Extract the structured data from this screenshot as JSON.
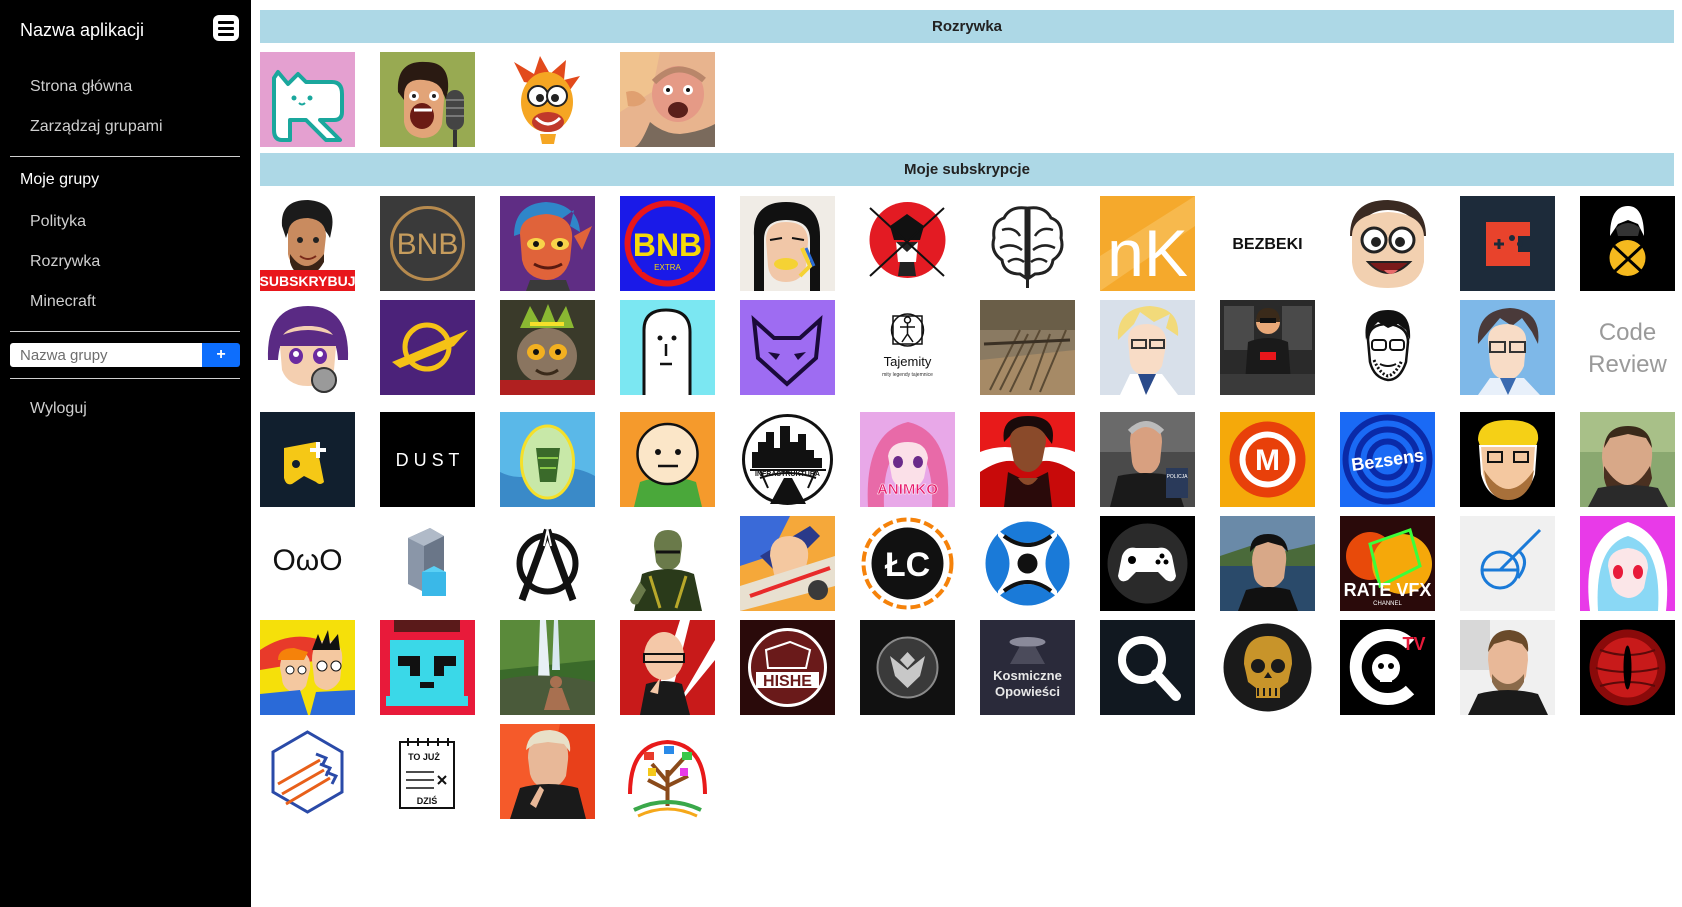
{
  "sidebar": {
    "app_title": "Nazwa aplikacji",
    "menu_icon": "hamburger-icon",
    "nav": [
      "Strona główna",
      "Zarządzaj grupami"
    ],
    "groups_title": "Moje grupy",
    "groups": [
      "Polityka",
      "Rozrywka",
      "Minecraft"
    ],
    "input_placeholder": "Nazwa grupy",
    "add_label": "+",
    "logout": "Wyloguj"
  },
  "sections": [
    {
      "title": "Rozrywka",
      "channels": 4
    },
    {
      "title": "Moje subskrypcje",
      "channels": 64
    }
  ],
  "avatar_texts": {
    "subskrybuj": "SUBSKRYBUJ",
    "bnb": "BNB",
    "bnb_extra_main": "BNB",
    "bnb_extra_sub": "EXTRA",
    "nk": "nK",
    "bezbeki": "BEZBEKI",
    "tajemity": "Tajemity",
    "tajemity_sub": "mity legendy tajemnice",
    "code": "Code",
    "review": "Review",
    "dust": "D U S T",
    "infrastruktura": "INFRASTRUKTURA",
    "animko": "ANIMKO",
    "m": "M",
    "bezsens": "Bezsens",
    "owo": "ОωО",
    "lc": "ŁC",
    "rate_vfx": "RATE VFX",
    "channel": "CHANNEL",
    "hishe": "HISHE",
    "kosmiczne": "Kosmiczne",
    "opowiesci": "Opowieści",
    "tv": "TV",
    "to_juz": "TO JUŻ",
    "dzis": "DZIŚ"
  }
}
